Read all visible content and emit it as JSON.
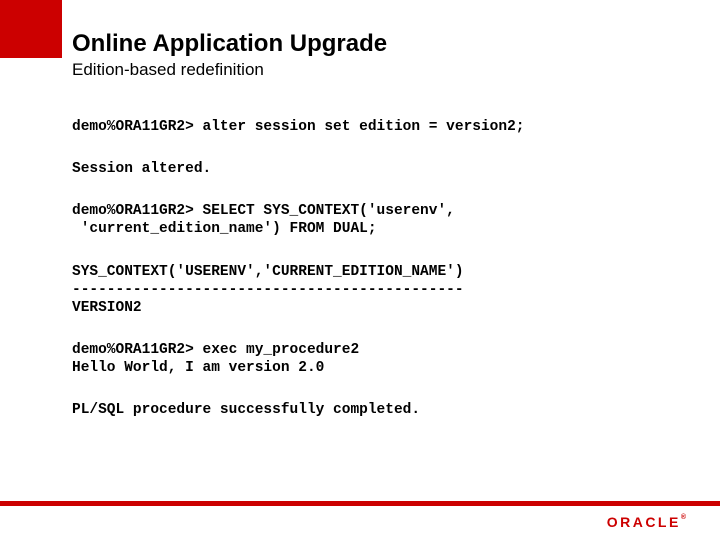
{
  "header": {
    "title": "Online Application Upgrade",
    "subtitle": "Edition-based redefinition"
  },
  "code_blocks": {
    "b0": "demo%ORA11GR2> alter session set edition = version2;",
    "b1": "Session altered.",
    "b2": "demo%ORA11GR2> SELECT SYS_CONTEXT('userenv',\n 'current_edition_name') FROM DUAL;",
    "b3": "SYS_CONTEXT('USERENV','CURRENT_EDITION_NAME')\n---------------------------------------------\nVERSION2",
    "b4": "demo%ORA11GR2> exec my_procedure2\nHello World, I am version 2.0",
    "b5": "PL/SQL procedure successfully completed."
  },
  "footer": {
    "logo": "ORACLE",
    "reg": "®"
  }
}
